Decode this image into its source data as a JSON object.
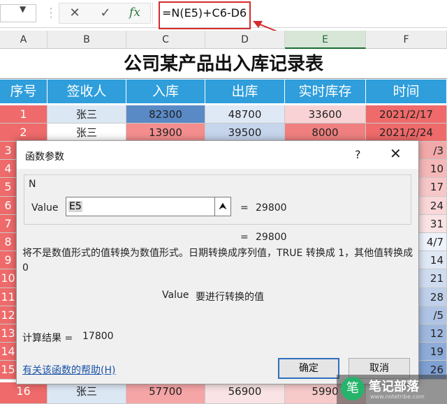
{
  "formula_bar": {
    "name_box": "",
    "cancel_icon": "✕",
    "enter_icon": "✓",
    "fx_label": "fx",
    "formula": "=N(E5)+C6-D6"
  },
  "columns": [
    "A",
    "B",
    "C",
    "D",
    "E",
    "F"
  ],
  "selected_column": "E",
  "sheet": {
    "title": "公司某产品出入库记录表",
    "headers": [
      "序号",
      "签收人",
      "入库",
      "出库",
      "实时库存",
      "时间"
    ],
    "rows": [
      {
        "no": "1",
        "name": "张三",
        "in": "82300",
        "out": "48700",
        "stock": "33600",
        "date": "2021/2/17"
      },
      {
        "no": "2",
        "name": "张三",
        "in": "13900",
        "out": "39500",
        "stock": "8000",
        "date": "2021/2/24"
      }
    ],
    "hidden_row_numbers": [
      "3",
      "4",
      "5",
      "6",
      "7",
      "8",
      "9",
      "10",
      "11",
      "12",
      "13",
      "14",
      "15"
    ],
    "right_edge_fragments": [
      "/3",
      "10",
      "17",
      "24",
      "31",
      "4/7",
      "14",
      "21",
      "28",
      "/5",
      "12",
      "19",
      "26"
    ],
    "last_row": {
      "no": "16",
      "name": "张三",
      "in": "57700",
      "out": "56900",
      "stock": "5990"
    }
  },
  "dialog": {
    "title": "函数参数",
    "help_icon": "?",
    "close_icon": "✕",
    "function_name": "N",
    "arg_label": "Value",
    "arg_input": "E5",
    "arg_collapse_icon": "⮝",
    "eq": "=",
    "arg_value": "29800",
    "result_value": "29800",
    "description": "将不是数值形式的值转换为数值形式。日期转换成序列值，TRUE 转换成 1，其他值转换成 0",
    "arg_desc_name": "Value",
    "arg_desc": "要进行转换的值",
    "calc_label": "计算结果 =",
    "calc_value": "17800",
    "help_link": "有关该函数的帮助(H)",
    "ok": "确定",
    "cancel": "取消"
  },
  "watermark": {
    "logo_icon": "笔",
    "name": "笔记部落",
    "url": "www.notetribe.com"
  },
  "colors": {
    "header_blue": "#2f9edb",
    "row_red": "#ef6a6a",
    "highlight_red": "#d62b2b",
    "selected_col": "#1e6b34"
  }
}
